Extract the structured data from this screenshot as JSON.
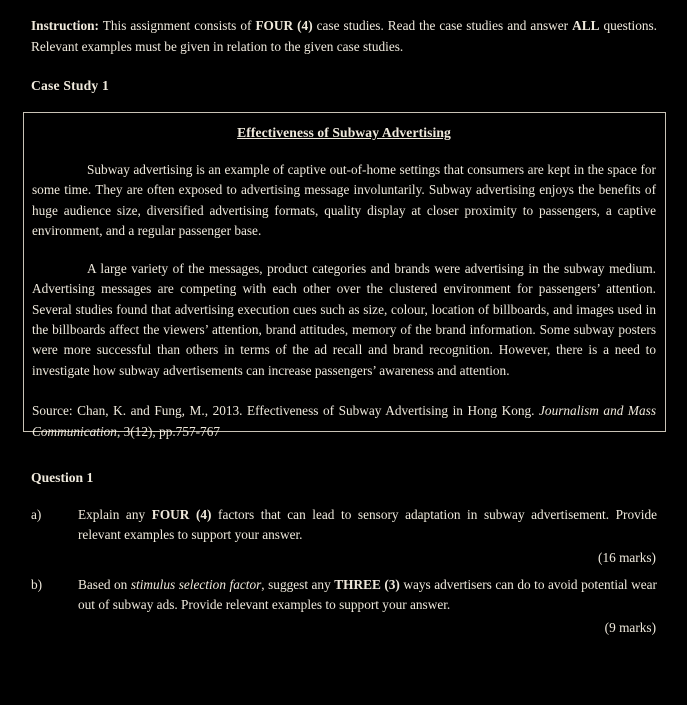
{
  "page": {
    "background_color": "#000000",
    "text_color": "#efe9dc",
    "border_color": "#c9c3b6"
  },
  "instruction": {
    "label": "Instruction:",
    "text_before_bold": " This assignment consists of ",
    "bold_count": "FOUR (4)",
    "text_middle": " case studies. Read the case studies and answer ",
    "bold_all": "ALL",
    "text_after": " questions. Relevant examples must be given in relation to the given case studies."
  },
  "case_study": {
    "heading": "Case Study 1",
    "box_title": "Effectiveness of Subway  Advertising",
    "paragraph_1": "Subway advertising is an example of captive out-of-home settings that consumers are kept in the space for some time. They are often exposed to advertising message involuntarily. Subway advertising enjoys the benefits of huge audience size, diversified advertising formats, quality display at closer proximity to passengers, a captive environment, and a regular passenger base.",
    "paragraph_2": "A large variety of the messages, product categories and brands were advertising in the subway medium. Advertising messages are competing with each other over the clustered environment for passengers’ attention. Several studies found that advertising execution cues such as size, colour, location of billboards, and images used in the billboards affect the viewers’ attention, brand attitudes, memory of the brand information. Some subway posters were more successful than others in terms of the ad recall and brand recognition. However, there is a need to investigate how subway advertisements can increase passengers’ awareness and attention.",
    "source_prefix": "Source: Chan, K. and Fung, M., 2013. Effectiveness of Subway Advertising in Hong Kong. ",
    "source_journal": "Journalism and Mass Communication",
    "source_suffix": ", 3(12), pp.757-767"
  },
  "question": {
    "heading": "Question 1",
    "parts": [
      {
        "label": "a)",
        "text_1": "Explain any ",
        "bold_1": "FOUR (4)",
        "text_2": " factors that can lead to sensory adaptation in subway advertisement. Provide relevant examples to support your answer.",
        "marks": "(16 marks)"
      },
      {
        "label": "b)",
        "text_1": "Based on ",
        "italic_1": "stimulus selection factor",
        "text_2": ", suggest any ",
        "bold_1": "THREE (3)",
        "text_3": " ways advertisers can do to avoid potential wear out of subway ads. Provide relevant examples to support your answer.",
        "marks": "(9 marks)"
      }
    ]
  }
}
